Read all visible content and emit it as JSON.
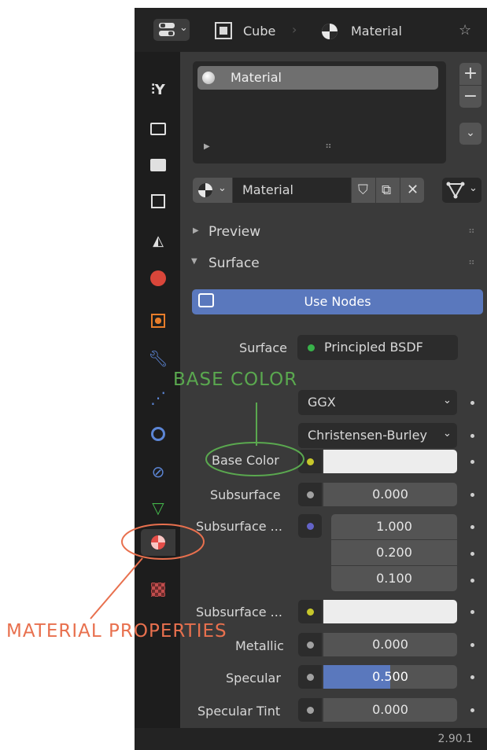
{
  "header": {
    "object_name": "Cube",
    "context_name": "Material"
  },
  "material_slots": {
    "items": [
      "Material"
    ]
  },
  "datablock": {
    "name": "Material"
  },
  "panels": {
    "preview": "Preview",
    "surface": "Surface"
  },
  "use_nodes_label": "Use Nodes",
  "properties": {
    "surface_label": "Surface",
    "surface_value": "Principled BSDF",
    "distribution": "GGX",
    "subsurface_method": "Christensen-Burley",
    "base_color_label": "Base Color",
    "base_color_value": "#ededed",
    "subsurface_label": "Subsurface",
    "subsurface_value": "0.000",
    "subsurface_radius_label": "Subsurface ...",
    "subsurface_radius_values": [
      "1.000",
      "0.200",
      "0.100"
    ],
    "subsurface_color_label": "Subsurface ...",
    "metallic_label": "Metallic",
    "metallic_value": "0.000",
    "specular_label": "Specular",
    "specular_value": "0.500",
    "specular_fill": 0.5,
    "specular_tint_label": "Specular Tint",
    "specular_tint_value": "0.000"
  },
  "version": "2.90.1",
  "annotations": {
    "base_color": "BASE COLOR",
    "material_properties": "MATERIAL PROPERTIES"
  },
  "colors": {
    "accent_blue": "#5a78bd",
    "annotation_green": "#5aa84f",
    "annotation_red": "#e8704e",
    "socket_yellow": "#c7c72b",
    "socket_gray": "#a1a1a1",
    "socket_purple": "#6363c7",
    "socket_green": "#38b24a"
  }
}
